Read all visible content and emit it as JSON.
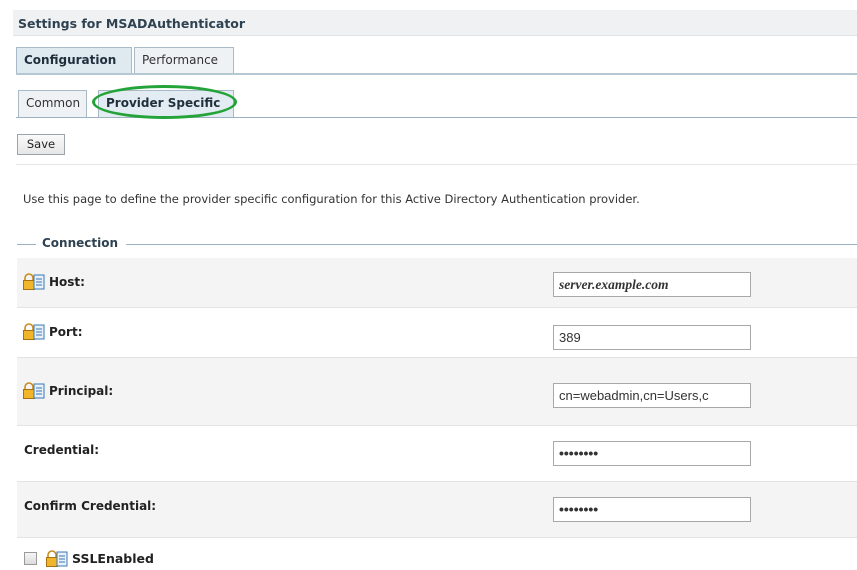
{
  "window": {
    "title": "Settings for MSADAuthenticator"
  },
  "tabs": [
    {
      "label": "Configuration",
      "selected": true
    },
    {
      "label": "Performance",
      "selected": false
    }
  ],
  "subtabs": [
    {
      "label": "Common",
      "selected": false
    },
    {
      "label": "Provider Specific",
      "selected": true
    }
  ],
  "toolbar": {
    "save_label": "Save"
  },
  "description": "Use this page to define the provider specific configuration for this Active Directory Authentication provider.",
  "section": {
    "title": "Connection"
  },
  "fields": {
    "host": {
      "label": "Host:",
      "value": "server.example.com"
    },
    "port": {
      "label": "Port:",
      "value": "389"
    },
    "principal": {
      "label": "Principal:",
      "value": "cn=webadmin,cn=Users,c"
    },
    "credential": {
      "label": "Credential:",
      "value": "••••••••"
    },
    "confirm_credential": {
      "label": "Confirm Credential:",
      "value": "••••••••"
    },
    "ssl_enabled": {
      "label": "SSLEnabled",
      "checked": false
    }
  },
  "colors": {
    "highlight": "#23a338",
    "tab_border": "#a9b9c6",
    "title_text": "#2e4252"
  },
  "icons": {
    "field_icon": "lock-config-icon"
  }
}
